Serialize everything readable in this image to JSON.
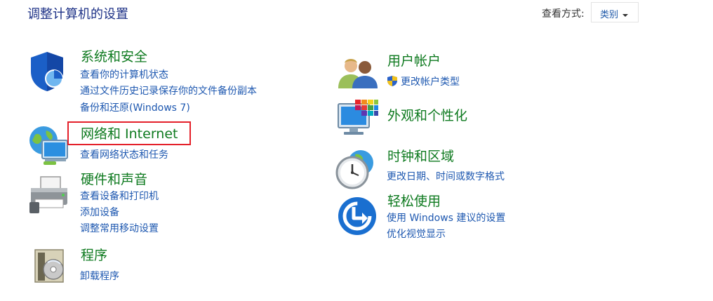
{
  "page": {
    "title": "调整计算机的设置"
  },
  "view_by": {
    "label": "查看方式:",
    "value": "类别"
  },
  "categories_left": [
    {
      "key": "security",
      "title": "系统和安全",
      "icon": "shield-icon",
      "links": [
        "查看你的计算机状态",
        "通过文件历史记录保存你的文件备份副本",
        "备份和还原(Windows 7)"
      ]
    },
    {
      "key": "network",
      "title": "网络和 Internet",
      "icon": "network-globe-icon",
      "links": [
        "查看网络状态和任务"
      ]
    },
    {
      "key": "hardware",
      "title": "硬件和声音",
      "icon": "printer-icon",
      "links": [
        "查看设备和打印机",
        "添加设备",
        "调整常用移动设置"
      ]
    },
    {
      "key": "programs",
      "title": "程序",
      "icon": "programs-disc-icon",
      "links": [
        "卸载程序"
      ]
    }
  ],
  "categories_right": [
    {
      "key": "accounts",
      "title": "用户帐户",
      "icon": "users-icon",
      "links": [
        "更改帐户类型"
      ]
    },
    {
      "key": "appearance",
      "title": "外观和个性化",
      "icon": "monitor-colors-icon",
      "links": []
    },
    {
      "key": "clock",
      "title": "时钟和区域",
      "icon": "clock-globe-icon",
      "links": [
        "更改日期、时间或数字格式"
      ]
    },
    {
      "key": "ease",
      "title": "轻松使用",
      "icon": "ease-of-access-icon",
      "links": [
        "使用 Windows 建议的设置",
        "优化视觉显示"
      ]
    }
  ],
  "colors": {
    "category_title": "#0e7a1f",
    "link": "#1e58b0",
    "highlight": "#e4202a",
    "page_title": "#1e3287"
  }
}
